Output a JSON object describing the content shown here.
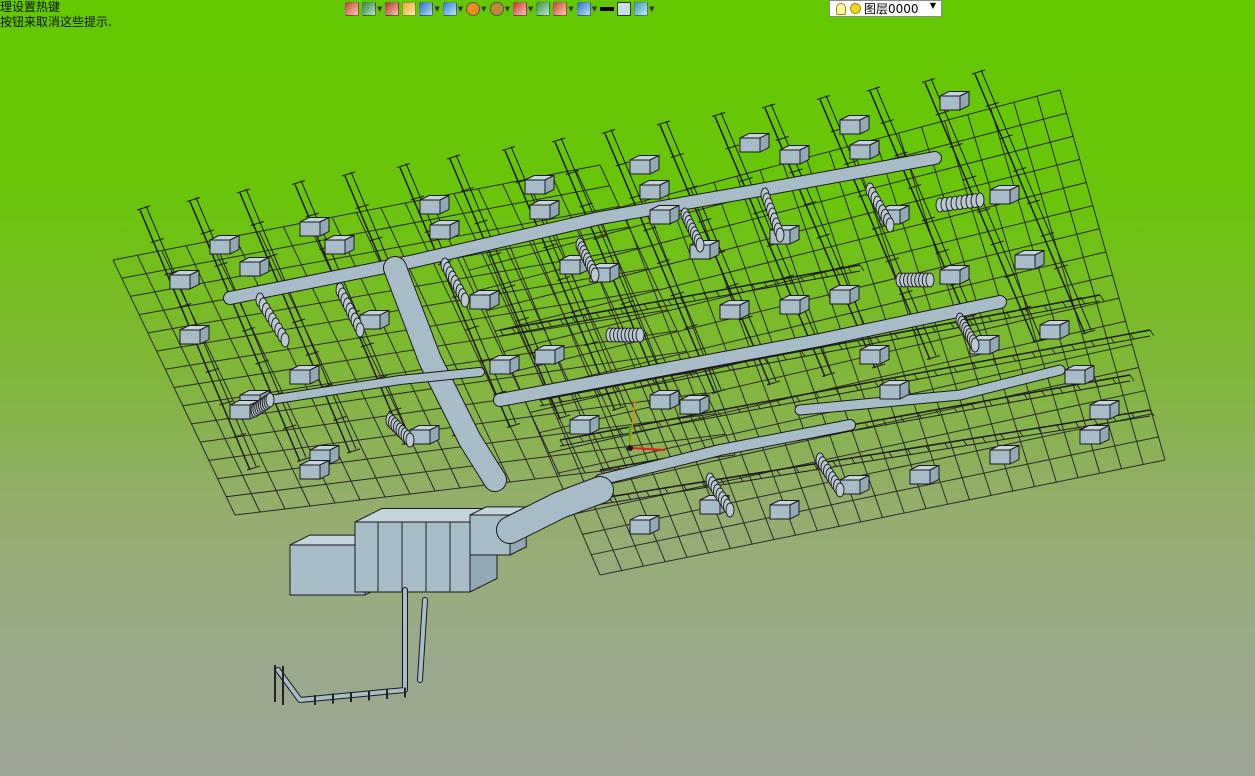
{
  "hints": {
    "line1": "理设置热键",
    "line2": "按钮来取消这些提示."
  },
  "toolbar": {
    "items": [
      {
        "icon": "exit-icon",
        "color": "#d0472c",
        "dropdown": false
      },
      {
        "icon": "pen-icon",
        "color": "#2f8e3a",
        "dropdown": true
      },
      {
        "icon": "brush-icon",
        "color": "#c0392b",
        "dropdown": false
      },
      {
        "icon": "block-icon",
        "color": "#e3b21c",
        "dropdown": false
      },
      {
        "icon": "cube-icon",
        "color": "#1f7ac8",
        "dropdown": true
      },
      {
        "icon": "box-view-icon",
        "color": "#2b8bd6",
        "dropdown": true
      },
      {
        "icon": "orbit-icon",
        "color": "#f08a1c",
        "dropdown": true
      },
      {
        "icon": "zoom-icon",
        "color": "#c08a3a",
        "dropdown": true
      },
      {
        "icon": "axis-icon",
        "color": "#d8342b",
        "dropdown": true
      },
      {
        "icon": "frame-icon",
        "color": "#2f9e44",
        "dropdown": false
      },
      {
        "icon": "column-icon",
        "color": "#d24a2a",
        "dropdown": true
      },
      {
        "icon": "render-icon",
        "color": "#2a7bd0",
        "dropdown": true
      },
      {
        "icon": "lineweight-icon",
        "color": "#000000",
        "dropdown": false
      },
      {
        "icon": "color-swatch-icon",
        "color": "#c8dde8",
        "dropdown": false
      },
      {
        "icon": "layers-icon",
        "color": "#3aa0b8",
        "dropdown": true
      }
    ],
    "layer": {
      "name": "图层0000"
    }
  },
  "colors": {
    "duct": "#a8bcc8",
    "duct_edge": "#1a1a1a",
    "grid": "#2a2a2a",
    "axis_x": "#e02020",
    "axis_y": "#19b819",
    "axis_z": "#e08a10"
  }
}
